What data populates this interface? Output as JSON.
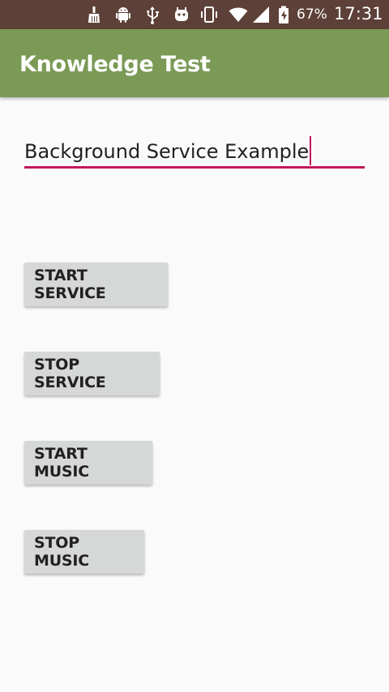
{
  "status_bar": {
    "battery_percent": "67%",
    "time": "17:31",
    "icons": [
      "broom-icon",
      "android-icon",
      "usb-icon",
      "robot-icon",
      "vibrate-icon",
      "wifi-icon",
      "signal-icon",
      "battery-charging-icon"
    ]
  },
  "app_bar": {
    "title": "Knowledge Test"
  },
  "edit_field": {
    "value": "Background Service Example"
  },
  "buttons": {
    "start_service": "START SERVICE",
    "stop_service": "STOP SERVICE",
    "start_music": "START MUSIC",
    "stop_music": "STOP MUSIC"
  },
  "colors": {
    "status_bar": "#5d4037",
    "app_bar": "#7b9a56",
    "accent": "#c2185b",
    "button": "#d6d7d7",
    "background": "#fafafa"
  }
}
